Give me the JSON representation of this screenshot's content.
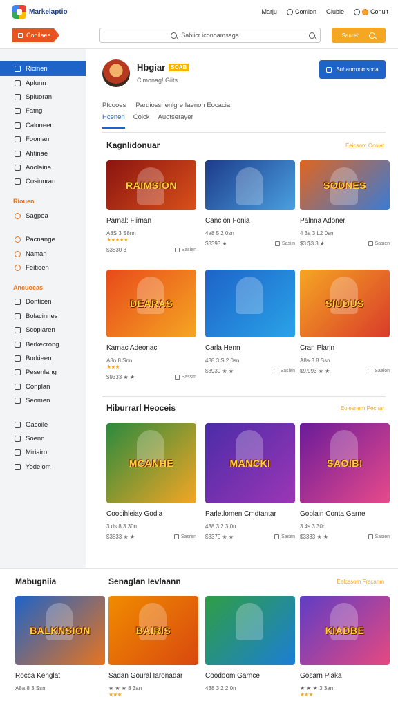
{
  "header": {
    "logo_text": "Markelaptio",
    "links": [
      "Marju",
      "Comion",
      "Giuble",
      "Conult"
    ]
  },
  "toolbar": {
    "category_button": "Conilaee",
    "search_placeholder": "Sabiicr iconoamsaga",
    "search_button": "Sanreh"
  },
  "sidebar": {
    "items_group1": [
      "Ricinen",
      "Aplunn",
      "Spluoran",
      "Fatng",
      "Caloneen",
      "Foonian",
      "Ahtinae",
      "Aoolaina",
      "Cosinnran"
    ],
    "head1": "Riouen",
    "items_group2": [
      "Sagpea"
    ],
    "items_group3": [
      "Pacnange",
      "Naman",
      "Feitioen"
    ],
    "head2": "Ancuoeas",
    "items_group4": [
      "Donticen",
      "Bolacinnes",
      "Scoplaren",
      "Berkecrong",
      "Borkieen",
      "Pesenlang",
      "Conplan",
      "Seomen"
    ],
    "items_group5": [
      "Gacoile",
      "Soenn",
      "Miriairo",
      "Yodeiom"
    ]
  },
  "profile": {
    "name": "Hbgiar",
    "badge": "SOAB",
    "subtitle": "Cimonag! Giits",
    "action_button": "Suhanrroomsona"
  },
  "breadcrumb": [
    "Pfcooes",
    "Pardiossnenlgre Iaenon Eocacia"
  ],
  "tabs": [
    "Hcenen",
    "Coick",
    "Auotserayer"
  ],
  "sections": [
    {
      "title": "Kagnlidonuar",
      "link": "Eeicsom Ocoiat",
      "cards": [
        {
          "name": "Parnal: Fiirnan",
          "meta": "A8S 3 S8nn",
          "price": "$3830 3",
          "rating": 5,
          "cart": "Sasien",
          "art": "RAIMSION",
          "colors": [
            "#8a1410",
            "#d9501a"
          ]
        },
        {
          "name": "Cancion Fonia",
          "meta": "4a8 5 2 0sn",
          "price": "$3393 ★",
          "rating": 0,
          "cart": "Sasiin",
          "art": "",
          "colors": [
            "#1d3b8a",
            "#4aa0e0"
          ]
        },
        {
          "name": "Palnna Adoner",
          "meta": "4 3a 3 L2 0sn",
          "price": "$3 $3 3 ★",
          "rating": 0,
          "cart": "Sasien",
          "art": "SODNES",
          "colors": [
            "#e0651f",
            "#3a7bd5"
          ]
        }
      ]
    },
    {
      "title": "",
      "link": "",
      "cards": [
        {
          "name": "Karnac Adeonac",
          "meta": "A8n 8 Snn",
          "price": "$9333 ★ ★",
          "rating": 3,
          "cart": "Sassm",
          "art": "DEARAS",
          "colors": [
            "#e84a1a",
            "#f5a623"
          ]
        },
        {
          "name": "Carla Henn",
          "meta": "438 3 S 2 0sn",
          "price": "$3930 ★ ★",
          "rating": 0,
          "cart": "Sasien",
          "art": "",
          "colors": [
            "#1e63c8",
            "#2aa3e8"
          ]
        },
        {
          "name": "Cran Plarjn",
          "meta": "A8a 3 8 Ssn",
          "price": "$9.993 ★ ★",
          "rating": 0,
          "cart": "Saelon",
          "art": "SIUDUS",
          "colors": [
            "#f5a623",
            "#d93b2a"
          ]
        }
      ]
    },
    {
      "title": "Hiburrarl Heoceis",
      "link": "Eolesnem Pecnar",
      "cards": [
        {
          "name": "Coocihleiay Godia",
          "meta": "3 ds 8 3 30n",
          "price": "$3833 ★ ★",
          "rating": 0,
          "cart": "Sasren",
          "art": "MCANHE",
          "colors": [
            "#2b8a3e",
            "#f5a623"
          ]
        },
        {
          "name": "Parletlomen Cmdtantar",
          "meta": "438 3 2 3 0n",
          "price": "$3370 ★ ★",
          "rating": 0,
          "cart": "Sasen",
          "art": "MANCKI",
          "colors": [
            "#4b2ca8",
            "#9c36b5"
          ]
        },
        {
          "name": "Goplain Conta Garne",
          "meta": "3 4s 3 30n",
          "price": "$3333 ★ ★",
          "rating": 0,
          "cart": "Sasien",
          "art": "SAOIB!",
          "colors": [
            "#6a1b9a",
            "#e84a8a"
          ]
        }
      ]
    }
  ],
  "bottom": {
    "left_title": "Mabugniia",
    "title": "Senaglan Ievlaann",
    "link": "Eelcssom Fracanm",
    "cards": [
      {
        "name": "Rocca Kenglat",
        "meta": "A8a 8 3 Ssn",
        "price": "",
        "rating": 0,
        "cart": "",
        "art": "BALKNSION",
        "colors": [
          "#1e63c8",
          "#e8741e"
        ]
      },
      {
        "name": "Sadan Goural Iaronadar",
        "meta": "★ ★ ★ 8 3an",
        "price": "",
        "rating": 3,
        "cart": "",
        "art": "BAIRIS",
        "colors": [
          "#f08c00",
          "#d9480f"
        ]
      },
      {
        "name": "Coodoom Garnce",
        "meta": "438 3 2 2 0n",
        "price": "",
        "rating": 0,
        "cart": "",
        "art": "",
        "colors": [
          "#2f9e44",
          "#1c7ed6"
        ]
      },
      {
        "name": "Gosarn Plaka",
        "meta": "★ ★ ★ 3 3an",
        "price": "",
        "rating": 3,
        "cart": "",
        "art": "KIADBE",
        "colors": [
          "#5f3dc4",
          "#e64980"
        ]
      }
    ]
  }
}
